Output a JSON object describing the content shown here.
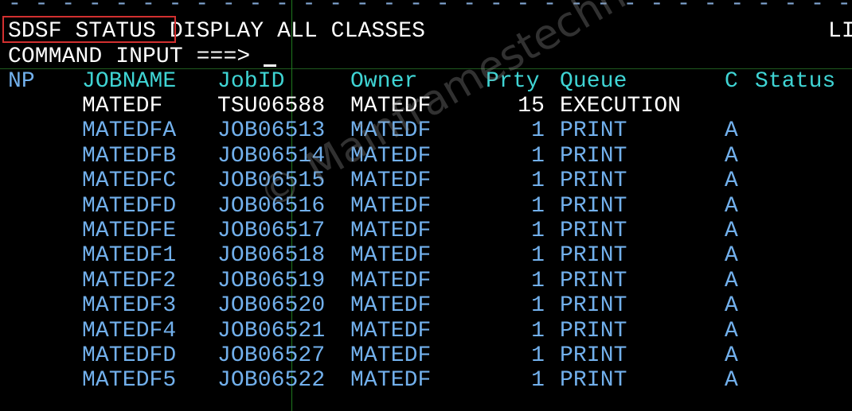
{
  "header": {
    "dash_line": "- - - - - - - - - - - - - - - - - - - - - - - - - - - - - - - - - - - - - - - - - - - - - - - - - - - - - - - - - - - - - - - - - - -",
    "title_highlight": "SDSF STATUS",
    "title_rest": "DISPLAY ALL CLASSES",
    "right_text": "LI",
    "command_label": "COMMAND INPUT ===>",
    "command_value": ""
  },
  "columns": {
    "np": "NP",
    "jobname": "JOBNAME",
    "jobid": "JobID",
    "owner": "Owner",
    "prty": "Prty",
    "queue": "Queue",
    "c": "C",
    "status": "Status"
  },
  "rows": [
    {
      "np": "",
      "jobname": "MATEDF",
      "jobid": "TSU06588",
      "owner": "MATEDF",
      "prty": "15",
      "queue": "EXECUTION",
      "c": "",
      "status": ""
    },
    {
      "np": "",
      "jobname": "MATEDFA",
      "jobid": "JOB06513",
      "owner": "MATEDF",
      "prty": "1",
      "queue": "PRINT",
      "c": "A",
      "status": ""
    },
    {
      "np": "",
      "jobname": "MATEDFB",
      "jobid": "JOB06514",
      "owner": "MATEDF",
      "prty": "1",
      "queue": "PRINT",
      "c": "A",
      "status": ""
    },
    {
      "np": "",
      "jobname": "MATEDFC",
      "jobid": "JOB06515",
      "owner": "MATEDF",
      "prty": "1",
      "queue": "PRINT",
      "c": "A",
      "status": ""
    },
    {
      "np": "",
      "jobname": "MATEDFD",
      "jobid": "JOB06516",
      "owner": "MATEDF",
      "prty": "1",
      "queue": "PRINT",
      "c": "A",
      "status": ""
    },
    {
      "np": "",
      "jobname": "MATEDFE",
      "jobid": "JOB06517",
      "owner": "MATEDF",
      "prty": "1",
      "queue": "PRINT",
      "c": "A",
      "status": ""
    },
    {
      "np": "",
      "jobname": "MATEDF1",
      "jobid": "JOB06518",
      "owner": "MATEDF",
      "prty": "1",
      "queue": "PRINT",
      "c": "A",
      "status": ""
    },
    {
      "np": "",
      "jobname": "MATEDF2",
      "jobid": "JOB06519",
      "owner": "MATEDF",
      "prty": "1",
      "queue": "PRINT",
      "c": "A",
      "status": ""
    },
    {
      "np": "",
      "jobname": "MATEDF3",
      "jobid": "JOB06520",
      "owner": "MATEDF",
      "prty": "1",
      "queue": "PRINT",
      "c": "A",
      "status": ""
    },
    {
      "np": "",
      "jobname": "MATEDF4",
      "jobid": "JOB06521",
      "owner": "MATEDF",
      "prty": "1",
      "queue": "PRINT",
      "c": "A",
      "status": ""
    },
    {
      "np": "",
      "jobname": "MATEDFD",
      "jobid": "JOB06527",
      "owner": "MATEDF",
      "prty": "1",
      "queue": "PRINT",
      "c": "A",
      "status": ""
    },
    {
      "np": "",
      "jobname": "MATEDF5",
      "jobid": "JOB06522",
      "owner": "MATEDF",
      "prty": "1",
      "queue": "PRINT",
      "c": "A",
      "status": ""
    }
  ],
  "watermark": "© Mainframestechhelp",
  "colors": {
    "background": "#000000",
    "header_text": "#ffffff",
    "column_header": "#3fd4d4",
    "row_text": "#72b0ec",
    "active_row_text": "#ffffff",
    "highlight_box": "#d23030"
  }
}
